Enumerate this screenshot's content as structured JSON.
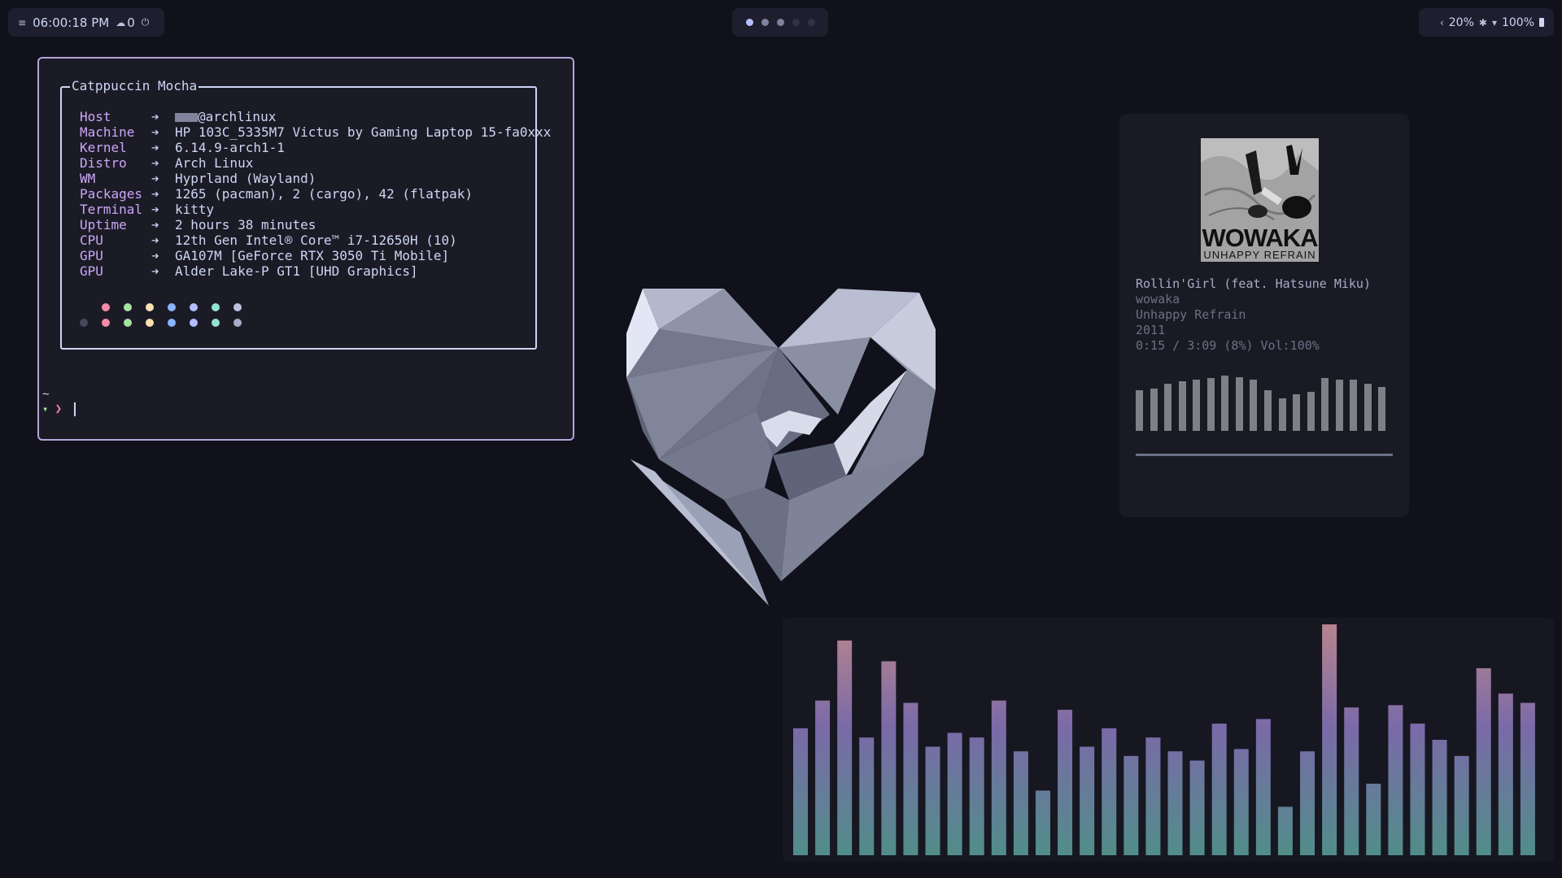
{
  "topbar": {
    "left": {
      "menu_icon": "menu-lines-icon",
      "clock": "06:00:18 PM",
      "notif_icon": "bell-icon",
      "notif_count": "0",
      "power_icon": "power-icon"
    },
    "workspaces": [
      {
        "state": "active"
      },
      {
        "state": "occupied"
      },
      {
        "state": "occupied"
      },
      {
        "state": "empty"
      },
      {
        "state": "empty"
      }
    ],
    "right": {
      "expand_icon": "chevron-left-icon",
      "brightness": "20%",
      "bluetooth_icon": "bluetooth-icon",
      "wifi_icon": "wifi-icon",
      "battery": "100%",
      "battery_icon": "battery-icon"
    }
  },
  "terminal": {
    "fastfetch": {
      "title": "Catppuccin Mocha",
      "arrow": "➔",
      "rows": [
        {
          "key": "Host",
          "value": "@archlinux",
          "redacted_prefix": true
        },
        {
          "key": "Machine",
          "value": "HP 103C_5335M7 Victus by Gaming Laptop 15-fa0xxx"
        },
        {
          "key": "Kernel",
          "value": "6.14.9-arch1-1"
        },
        {
          "key": "Distro",
          "value": "Arch Linux"
        },
        {
          "key": "WM",
          "value": "Hyprland (Wayland)"
        },
        {
          "key": "Packages",
          "value": "1265 (pacman), 2 (cargo), 42 (flatpak)"
        },
        {
          "key": "Terminal",
          "value": "kitty"
        },
        {
          "key": "Uptime",
          "value": "2 hours 38 minutes"
        },
        {
          "key": "CPU",
          "value": "12th Gen Intel® Core™ i7-12650H (10)"
        },
        {
          "key": "GPU",
          "value": "GA107M [GeForce RTX 3050 Ti Mobile]"
        },
        {
          "key": "GPU",
          "value": "Alder Lake-P GT1 [UHD Graphics]"
        }
      ],
      "palette_row1": [
        "",
        "#f38ba8",
        "#a6e3a1",
        "#f9e2af",
        "#89b4fa",
        "#b4befe",
        "#94e2d5",
        "#bac2de"
      ],
      "palette_row2": [
        "#45475a",
        "#f38ba8",
        "#a6e3a1",
        "#f9e2af",
        "#89b4fa",
        "#b4befe",
        "#94e2d5",
        "#a6adc8"
      ]
    },
    "prompt": {
      "cwd": "~",
      "os_icon": "arch-icon",
      "symbol": "❯"
    }
  },
  "music": {
    "cover": {
      "line1": "WOWAKA",
      "line2": "UNHAPPY REFRAIN"
    },
    "title": "Rollin'Girl (feat. Hatsune Miku)",
    "artist": "wowaka",
    "album": "Unhappy Refrain",
    "year": "2011",
    "status": "0:15 / 3:09 (8%) Vol:100%",
    "bars": [
      0.7,
      0.72,
      0.8,
      0.85,
      0.88,
      0.9,
      0.94,
      0.91,
      0.88,
      0.7,
      0.56,
      0.63,
      0.66,
      0.9,
      0.88,
      0.88,
      0.8,
      0.75
    ]
  },
  "visualizer": {
    "colors": {
      "top": "#b4838f",
      "mid": "#7a6aa8",
      "bottom": "#4f8f88"
    },
    "bars": [
      0.55,
      0.67,
      0.93,
      0.51,
      0.84,
      0.66,
      0.47,
      0.53,
      0.51,
      0.67,
      0.45,
      0.28,
      0.63,
      0.47,
      0.55,
      0.43,
      0.51,
      0.45,
      0.41,
      0.57,
      0.46,
      0.59,
      0.21,
      0.45,
      1.0,
      0.64,
      0.31,
      0.65,
      0.57,
      0.5,
      0.43,
      0.81,
      0.7,
      0.66
    ]
  }
}
